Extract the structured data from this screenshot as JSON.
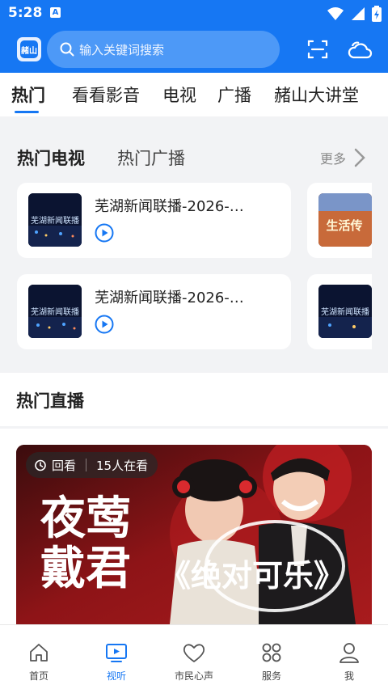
{
  "status": {
    "time": "5:28",
    "a_icon": "A"
  },
  "header": {
    "logo_text": "赭山",
    "search_placeholder": "输入关键词搜索",
    "scan_icon": "scan-icon",
    "weather_icon": "cloud-icon"
  },
  "tabs": [
    {
      "label": "热门",
      "active": true
    },
    {
      "label": "看看影音",
      "active": false
    },
    {
      "label": "电视",
      "active": false
    },
    {
      "label": "广播",
      "active": false
    },
    {
      "label": "赭山大讲堂",
      "active": false
    }
  ],
  "hot_section": {
    "tab_tv": "热门电视",
    "tab_radio": "热门广播",
    "more": "更多",
    "items": [
      {
        "title": "芜湖新闻联播-2026-…",
        "thumb_text": "芜湖新闻联播"
      },
      {
        "title": "芜湖新闻联播-2026-…",
        "thumb_text": "芜湖新闻联播"
      }
    ],
    "side_items": [
      {
        "thumb_text": "生活传"
      },
      {
        "thumb_text": "芜湖新闻联播"
      }
    ]
  },
  "live_section": {
    "title": "热门直播",
    "badge_replay": "回看",
    "badge_viewers": "15人在看",
    "banner_text_1": "夜莺",
    "banner_text_2": "戴君",
    "banner_text_3": "《绝对可乐》"
  },
  "bottom_nav": [
    {
      "label": "首页",
      "icon": "home-icon",
      "active": false
    },
    {
      "label": "视听",
      "icon": "tv-icon",
      "active": true
    },
    {
      "label": "市民心声",
      "icon": "heart-icon",
      "active": false
    },
    {
      "label": "服务",
      "icon": "grid-icon",
      "active": false
    },
    {
      "label": "我",
      "icon": "user-icon",
      "active": false
    }
  ],
  "colors": {
    "primary": "#1677f3",
    "text": "#222222",
    "muted": "#888888"
  }
}
